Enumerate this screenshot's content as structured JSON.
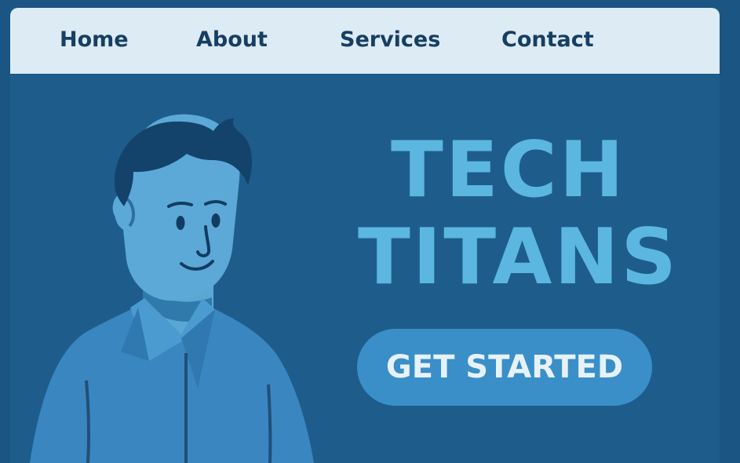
{
  "nav": {
    "items": [
      {
        "label": "Home"
      },
      {
        "label": "About"
      },
      {
        "label": "Services"
      },
      {
        "label": "Contact"
      }
    ]
  },
  "hero": {
    "title_line1": "TECH",
    "title_line2": "TITANS",
    "cta_label": "GET STARTED"
  },
  "colors": {
    "background": "#1e5d8b",
    "nav_background": "#dcebf4",
    "nav_text": "#173e63",
    "title": "#5bb7e0",
    "cta": "#3a8fc8",
    "cta_text": "#e7f2f8"
  },
  "illustration": {
    "icon": "man-in-shirt-illustration"
  }
}
